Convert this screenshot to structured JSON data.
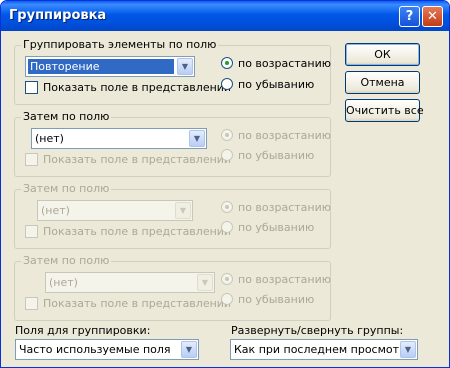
{
  "window": {
    "title": "Группировка",
    "help_glyph": "?",
    "close_glyph": "✕"
  },
  "groups": [
    {
      "legend": "Группировать элементы по полю",
      "field": "Повторение",
      "show_in_view": "Показать поле в представлении",
      "asc": "по возрастанию",
      "desc": "по убыванию",
      "enabled": true,
      "sort": "asc"
    },
    {
      "legend": "Затем по полю",
      "field": "(нет)",
      "show_in_view": "Показать поле в представлении",
      "asc": "по возрастанию",
      "desc": "по убыванию",
      "enabled": true,
      "sort": "asc"
    },
    {
      "legend": "Затем по полю",
      "field": "(нет)",
      "show_in_view": "Показать поле в представлении",
      "asc": "по возрастанию",
      "desc": "по убыванию",
      "enabled": false,
      "sort": "asc"
    },
    {
      "legend": "Затем по полю",
      "field": "(нет)",
      "show_in_view": "Показать поле в представлении",
      "asc": "по возрастанию",
      "desc": "по убыванию",
      "enabled": false,
      "sort": "asc"
    }
  ],
  "buttons": {
    "ok": "ОК",
    "cancel": "Отмена",
    "clear": "Очистить все"
  },
  "fields_for_grouping": {
    "label": "Поля для группировки:",
    "value": "Часто используемые поля"
  },
  "expand_collapse": {
    "label": "Развернуть/свернуть группы:",
    "value": "Как при последнем просмотре"
  },
  "colors": {
    "title_bar": "#0058e6",
    "selection": "#316ac5",
    "disabled_text": "#aca899",
    "dialog_bg": "#ece9d8"
  }
}
